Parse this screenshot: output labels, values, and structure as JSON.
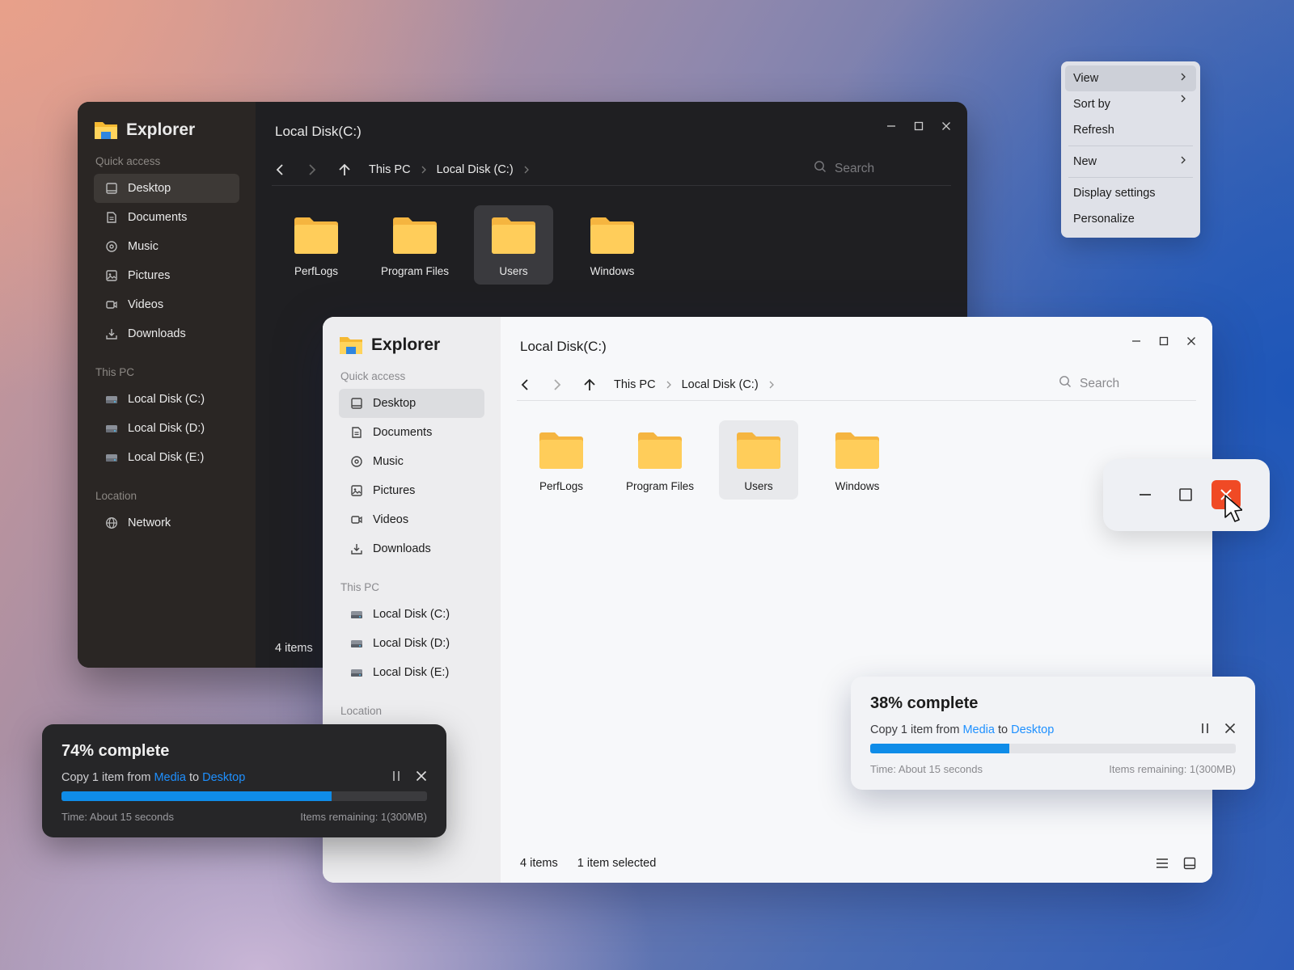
{
  "colors": {
    "accent": "#1e90ff",
    "progress": "#0f8ce8",
    "close_red": "#f04a25",
    "folder": "#fbcb5a"
  },
  "explorer": {
    "app_name": "Explorer",
    "title": "Local Disk(C:)",
    "quick_access_label": "Quick access",
    "quick_access": [
      "Desktop",
      "Documents",
      "Music",
      "Pictures",
      "Videos",
      "Downloads"
    ],
    "this_pc_label": "This PC",
    "drives": [
      "Local Disk (C:)",
      "Local Disk (D:)",
      "Local Disk (E:)"
    ],
    "location_label": "Location",
    "locations": [
      "Network"
    ],
    "breadcrumb": [
      "This PC",
      "Local Disk (C:)"
    ],
    "search_placeholder": "Search",
    "files": [
      "PerfLogs",
      "Program Files",
      "Users",
      "Windows"
    ],
    "selected_file": "Users",
    "item_count": "4 items",
    "selection_status": "1 item selected"
  },
  "context_menu": {
    "items": [
      "View",
      "Sort by",
      "Refresh",
      "New",
      "Display settings",
      "Personalize"
    ],
    "highlighted": "View"
  },
  "copy_dark": {
    "percent_label": "74% complete",
    "progress": 0.74,
    "prefix": "Copy 1 item from",
    "source": "Media",
    "to": "to",
    "destination": "Desktop",
    "time": "Time: About 15 seconds",
    "remaining": "Items remaining: 1(300MB)"
  },
  "copy_light": {
    "percent_label": "38% complete",
    "progress": 0.38,
    "prefix": "Copy 1 item from",
    "source": "Media",
    "to": "to",
    "destination": "Desktop",
    "time": "Time: About 15 seconds",
    "remaining": "Items remaining: 1(300MB)"
  }
}
